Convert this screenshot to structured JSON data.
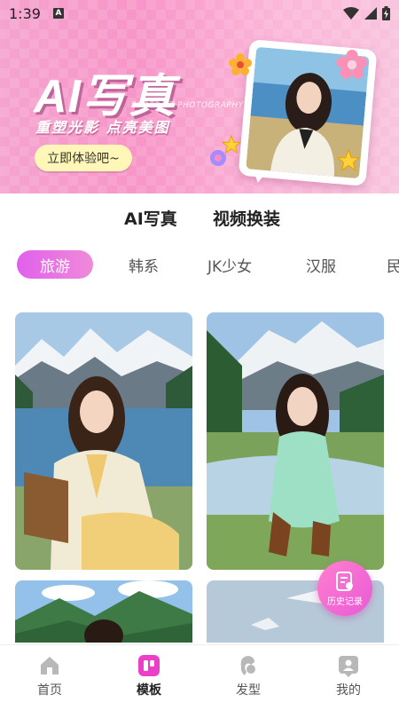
{
  "status_bar": {
    "time": "1:39",
    "notification_badge": "A",
    "icons": [
      "wifi-icon",
      "signal-icon",
      "battery-icon"
    ]
  },
  "banner": {
    "title": "AI写真",
    "subtitle_en": "PORTRAIT PHOTOGRAPHY",
    "slogan": "重塑光影  点亮美图",
    "cta_label": "立即体验吧~"
  },
  "type_tabs": [
    {
      "label": "AI写真",
      "active": true
    },
    {
      "label": "视频换装",
      "active": false
    }
  ],
  "style_tabs": [
    {
      "label": "旅游",
      "active": true
    },
    {
      "label": "韩系",
      "active": false
    },
    {
      "label": "JK少女",
      "active": false
    },
    {
      "label": "汉服",
      "active": false
    },
    {
      "label": "民",
      "active": false
    }
  ],
  "history_button": {
    "label": "历史记录"
  },
  "bottom_nav": [
    {
      "label": "首页",
      "icon": "home-icon",
      "active": false
    },
    {
      "label": "模板",
      "icon": "template-icon",
      "active": true
    },
    {
      "label": "发型",
      "icon": "hairstyle-icon",
      "active": false
    },
    {
      "label": "我的",
      "icon": "profile-icon",
      "active": false
    }
  ],
  "colors": {
    "accent": "#e961d8",
    "banner_pink": "#f796c8",
    "cta_yellow": "#fff7b8"
  }
}
